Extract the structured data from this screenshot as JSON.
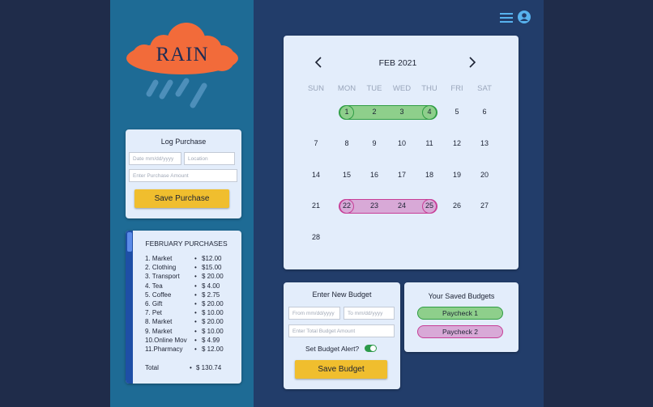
{
  "logo": {
    "text": "RAIN"
  },
  "header": {
    "menu_icon": "hamburger-menu-icon",
    "account_icon": "user-account-icon"
  },
  "log_purchase": {
    "title": "Log Purchase",
    "date_placeholder": "Date mm/dd/yyyy",
    "location_placeholder": "Location",
    "amount_placeholder": "Enter Purchase Amount",
    "save_label": "Save Purchase"
  },
  "purchases": {
    "title": "FEBRUARY PURCHASES",
    "items": [
      {
        "name": "1. Market",
        "amount": "$12.00"
      },
      {
        "name": "2. Clothing",
        "amount": "$15.00"
      },
      {
        "name": "3. Transport",
        "amount": "$ 20.00"
      },
      {
        "name": "4. Tea",
        "amount": "$   4.00"
      },
      {
        "name": "5. Coffee",
        "amount": "$   2.75"
      },
      {
        "name": "6. Gift",
        "amount": "$ 20.00"
      },
      {
        "name": "7. Pet",
        "amount": "$ 10.00"
      },
      {
        "name": "8. Market",
        "amount": "$ 20.00"
      },
      {
        "name": "9. Market",
        "amount": "$ 10.00"
      },
      {
        "name": "10.Online Mov",
        "amount": "$   4.99"
      },
      {
        "name": "11.Pharmacy",
        "amount": "$ 12.00"
      }
    ],
    "bullet": "•",
    "total_label": "Total",
    "total_value": "$ 130.74"
  },
  "calendar": {
    "month_label": "FEB 2021",
    "prev_icon": "chevron-left-icon",
    "next_icon": "chevron-right-icon",
    "weekdays": [
      "SUN",
      "MON",
      "TUE",
      "WED",
      "THU",
      "FRI",
      "SAT"
    ],
    "weeks": [
      [
        "",
        "1",
        "2",
        "3",
        "4",
        "5",
        "6"
      ],
      [
        "7",
        "8",
        "9",
        "10",
        "11",
        "12",
        "13"
      ],
      [
        "14",
        "15",
        "16",
        "17",
        "18",
        "19",
        "20"
      ],
      [
        "21",
        "22",
        "23",
        "24",
        "25",
        "26",
        "27"
      ],
      [
        "28",
        "",
        "",
        "",
        "",
        "",
        ""
      ]
    ],
    "ranges": [
      {
        "color": "green",
        "start": "1",
        "end": "4"
      },
      {
        "color": "pink",
        "start": "22",
        "end": "25"
      }
    ]
  },
  "new_budget": {
    "title": "Enter New Budget",
    "from_placeholder": "From mm/dd/yyyy",
    "to_placeholder": "To mm/dd/yyyy",
    "amount_placeholder": "Enter Total Budget Amount",
    "alert_label": "Set Budget Alert?",
    "alert_on": true,
    "save_label": "Save Budget"
  },
  "saved_budgets": {
    "title": "Your Saved Budgets",
    "items": [
      {
        "label": "Paycheck 1",
        "color": "green"
      },
      {
        "label": "Paycheck 2",
        "color": "pink"
      }
    ]
  },
  "colors": {
    "background": "#1f2c4a",
    "sidebar": "#1e6b95",
    "main": "#223d6a",
    "card": "#e3edfb",
    "accent_yellow": "#f0be2e",
    "cloud_orange": "#f26b3a",
    "green_range": "#8ecf8b",
    "pink_range": "#d8a9d7"
  }
}
